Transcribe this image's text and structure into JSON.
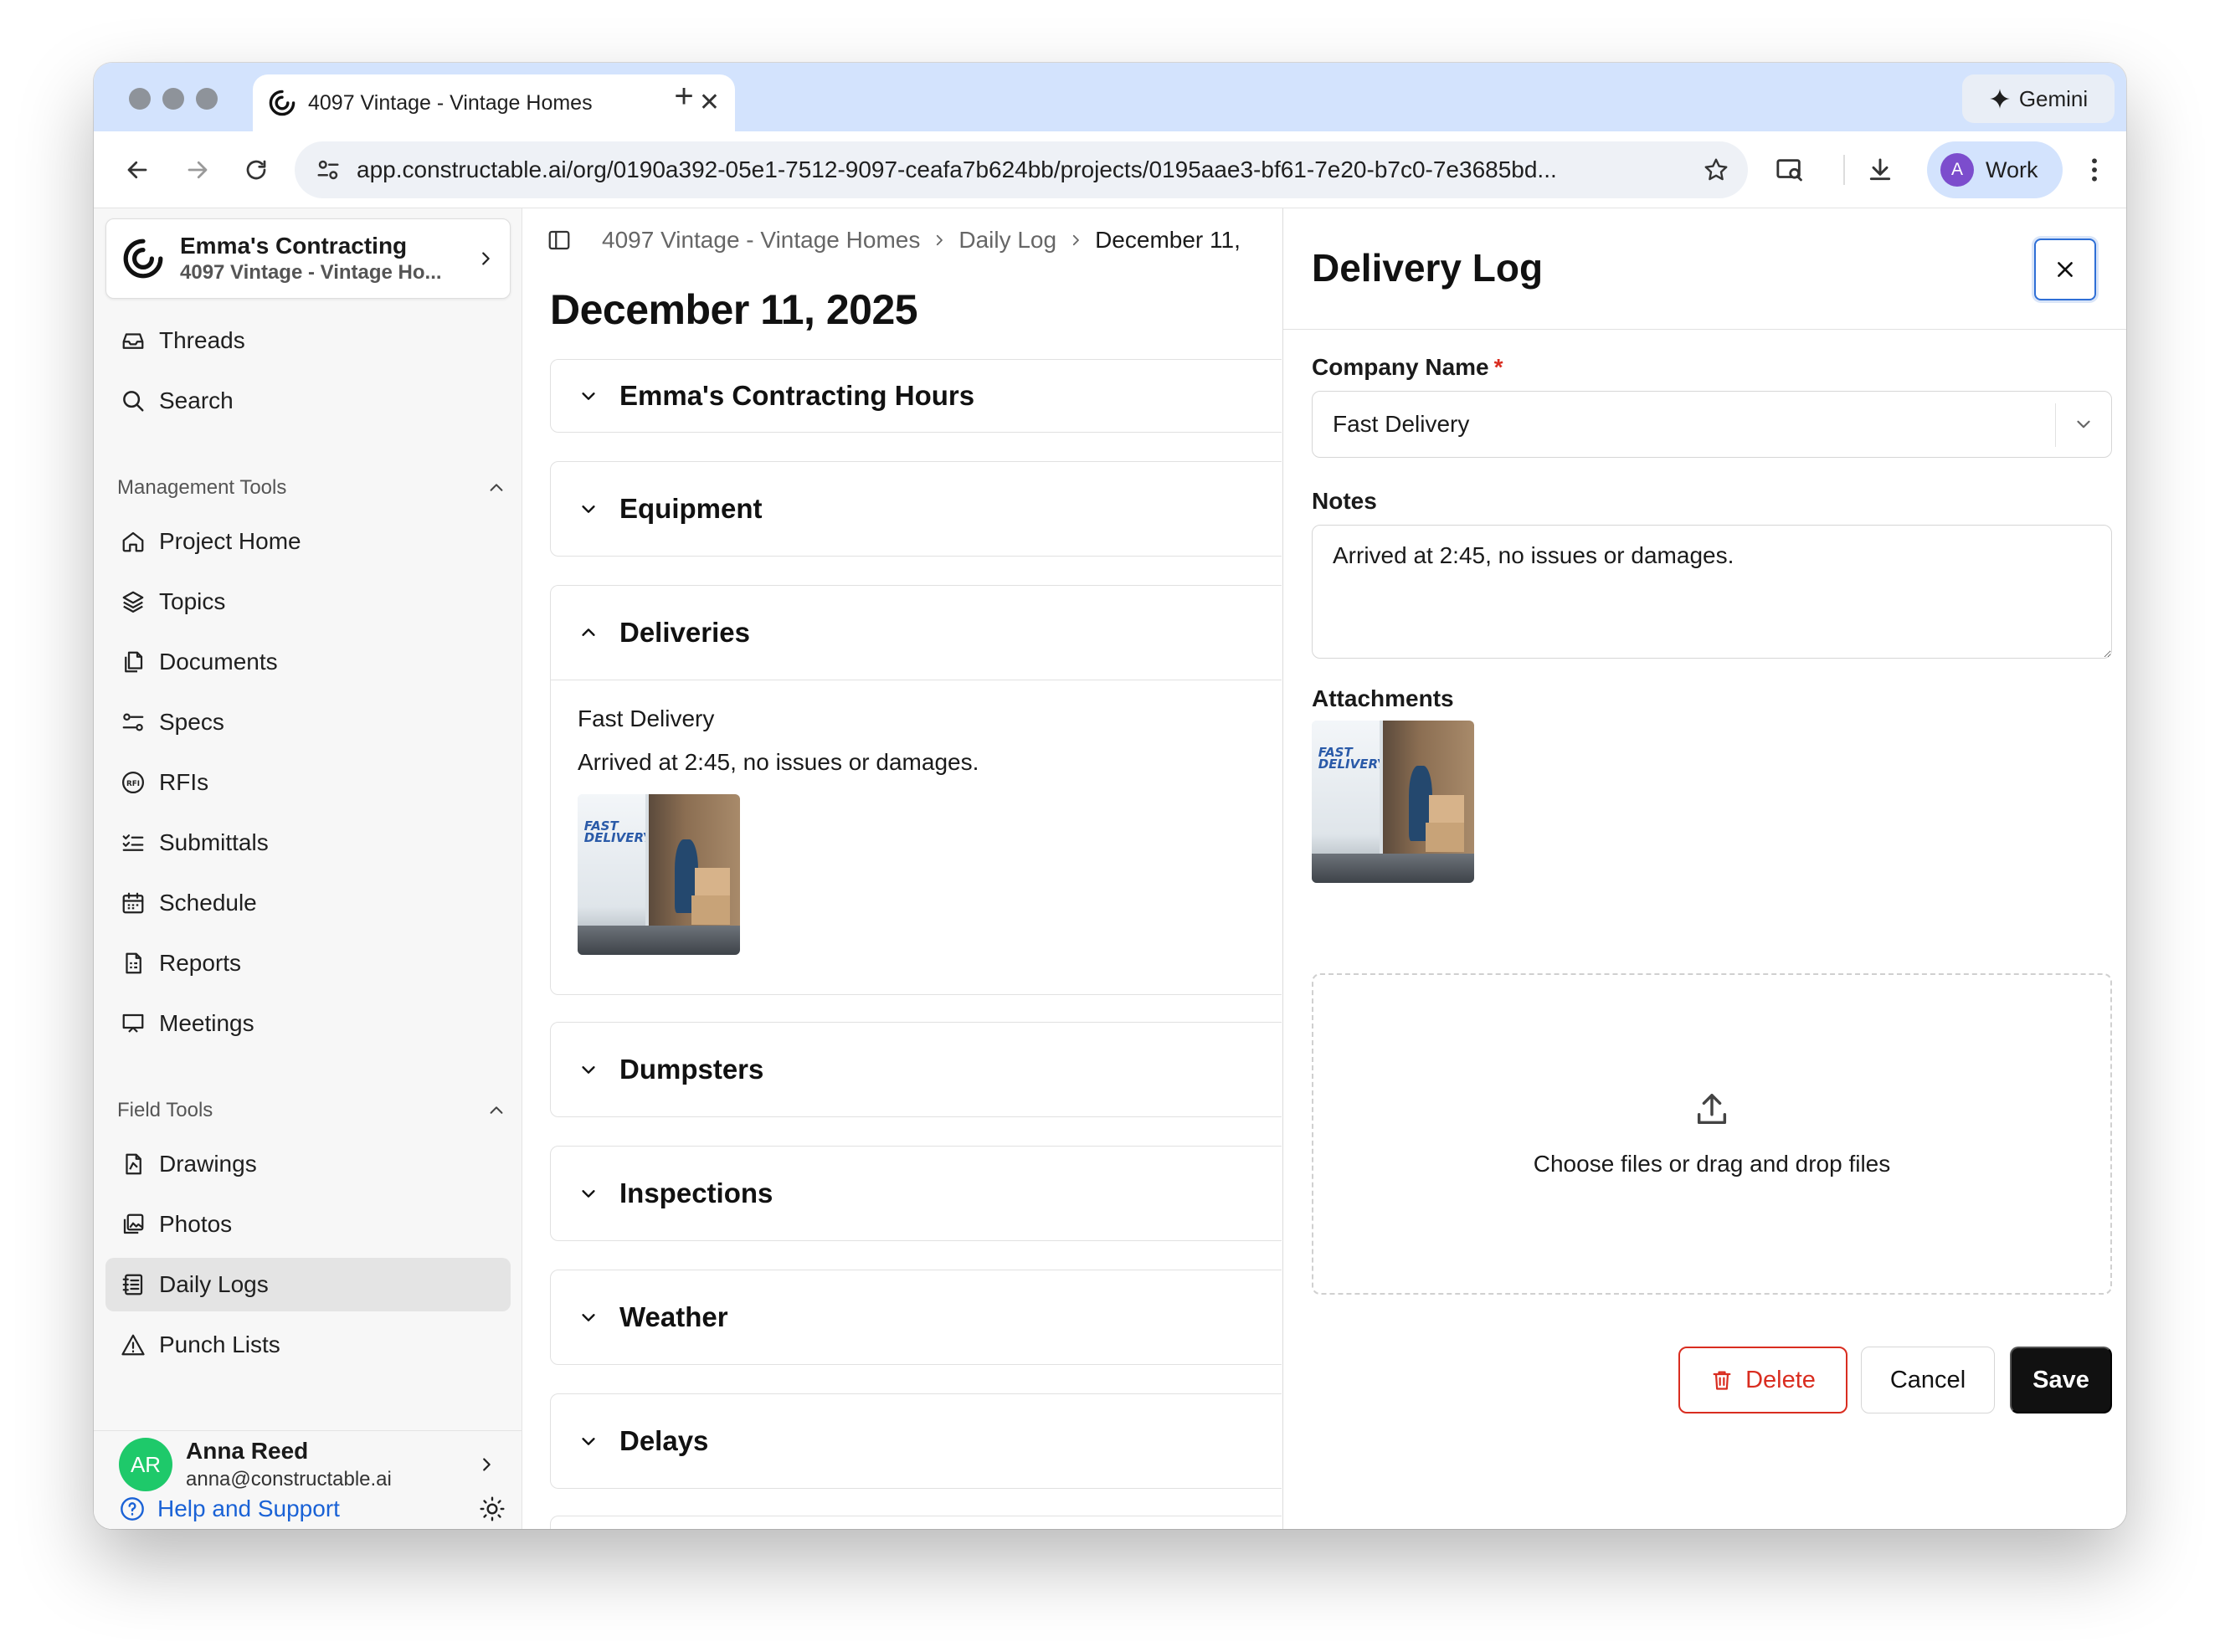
{
  "browser": {
    "tab_title": "4097 Vintage - Vintage Homes",
    "new_tab": "+",
    "gemini_label": "Gemini",
    "url": "app.constructable.ai/org/0190a392-05e1-7512-9097-ceafa7b624bb/projects/0195aae3-bf61-7e20-b7c0-7e3685bd...",
    "profile_initial": "A",
    "profile_label": "Work"
  },
  "sidebar": {
    "org_name": "Emma's Contracting",
    "project_name": "4097 Vintage - Vintage Ho...",
    "top_items": [
      {
        "label": "Threads",
        "icon": "inbox-icon"
      },
      {
        "label": "Search",
        "icon": "search-icon"
      }
    ],
    "management_header": "Management Tools",
    "management_items": [
      {
        "label": "Project Home",
        "icon": "home-icon"
      },
      {
        "label": "Topics",
        "icon": "layers-icon"
      },
      {
        "label": "Documents",
        "icon": "documents-icon"
      },
      {
        "label": "Specs",
        "icon": "specs-icon"
      },
      {
        "label": "RFIs",
        "icon": "rfi-icon"
      },
      {
        "label": "Submittals",
        "icon": "checklist-icon"
      },
      {
        "label": "Schedule",
        "icon": "calendar-icon"
      },
      {
        "label": "Reports",
        "icon": "report-icon"
      },
      {
        "label": "Meetings",
        "icon": "presentation-icon"
      }
    ],
    "field_header": "Field Tools",
    "field_items": [
      {
        "label": "Drawings",
        "icon": "drawing-icon"
      },
      {
        "label": "Photos",
        "icon": "photos-icon"
      },
      {
        "label": "Daily Logs",
        "icon": "daily-log-icon",
        "active": true
      },
      {
        "label": "Punch Lists",
        "icon": "warning-icon"
      }
    ],
    "user": {
      "initials": "AR",
      "name": "Anna Reed",
      "email": "anna@constructable.ai"
    },
    "help_label": "Help and Support"
  },
  "main": {
    "breadcrumb": [
      "4097 Vintage - Vintage Homes",
      "Daily Log",
      "December 11,"
    ],
    "title": "December 11, 2025",
    "sections": [
      {
        "label": "Emma's Contracting Hours",
        "expanded": false
      },
      {
        "label": "Equipment",
        "expanded": false
      },
      {
        "label": "Deliveries",
        "expanded": true
      },
      {
        "label": "Dumpsters",
        "expanded": false
      },
      {
        "label": "Inspections",
        "expanded": false
      },
      {
        "label": "Weather",
        "expanded": false
      },
      {
        "label": "Delays",
        "expanded": false
      }
    ],
    "delivery": {
      "company": "Fast Delivery",
      "notes": "Arrived at 2:45, no issues or damages.",
      "photo_text": "FAST\nDELIVERY"
    }
  },
  "panel": {
    "title": "Delivery Log",
    "company_label": "Company Name",
    "required_mark": "*",
    "company_value": "Fast Delivery",
    "notes_label": "Notes",
    "notes_value": "Arrived at 2:45, no issues or damages.",
    "attachments_label": "Attachments",
    "dropzone_text": "Choose files or drag and drop files",
    "delete_label": "Delete",
    "cancel_label": "Cancel",
    "save_label": "Save"
  },
  "colors": {
    "tabstrip": "#d3e3fd",
    "accent_blue": "#2f6fd6",
    "danger": "#d92d20",
    "avatar_green": "#1ec96a",
    "primary_button": "#111111"
  }
}
